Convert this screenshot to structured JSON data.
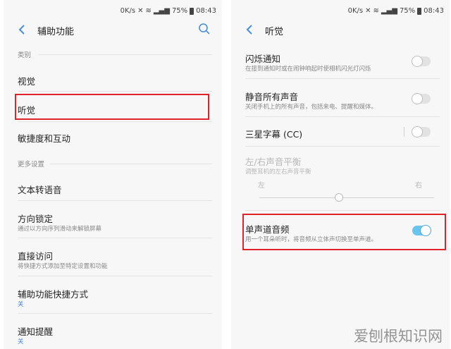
{
  "status_bar": {
    "speed": "0K/s",
    "battery": "75%",
    "time": "08:43"
  },
  "left": {
    "title": "辅助功能",
    "section_category": "类别",
    "vision": "视觉",
    "hearing": "听觉",
    "dexterity": "敏捷度和互动",
    "section_more": "更多设置",
    "tts": "文本转语音",
    "direction_lock": {
      "label": "方向锁定",
      "desc": "通过以方向序列滑动来解锁屏幕"
    },
    "direct_access": {
      "label": "直接访问",
      "desc": "将快捷方式添加至特定设置和功能"
    },
    "shortcut": {
      "label": "辅助功能快捷方式",
      "value": "关"
    },
    "notification": {
      "label": "通知提醒",
      "value": "关"
    }
  },
  "right": {
    "title": "听觉",
    "flash": {
      "label": "闪烁通知",
      "desc": "在接到通知时或在闹钟响起时使相机闪光灯闪烁",
      "on": false
    },
    "mute": {
      "label": "静音所有声音",
      "desc": "关闭手机上的所有声音，包括来电、提醒和媒体。",
      "on": false
    },
    "caption": {
      "label": "三星字幕 (CC)",
      "on": false
    },
    "balance": {
      "label": "左/右声音平衡",
      "desc": "调整耳机的左右声音平衡",
      "left": "左",
      "right": "右",
      "value": 0.5
    },
    "mono": {
      "label": "单声道音频",
      "desc": "用一个耳朵听时，将音频从立体声切换至单声道。",
      "on": true
    }
  },
  "watermark": "爱刨根知识网",
  "colors": {
    "highlight": "#e0232b",
    "toggle_on": "#6ac5ee",
    "accent": "#3a7fd6"
  }
}
